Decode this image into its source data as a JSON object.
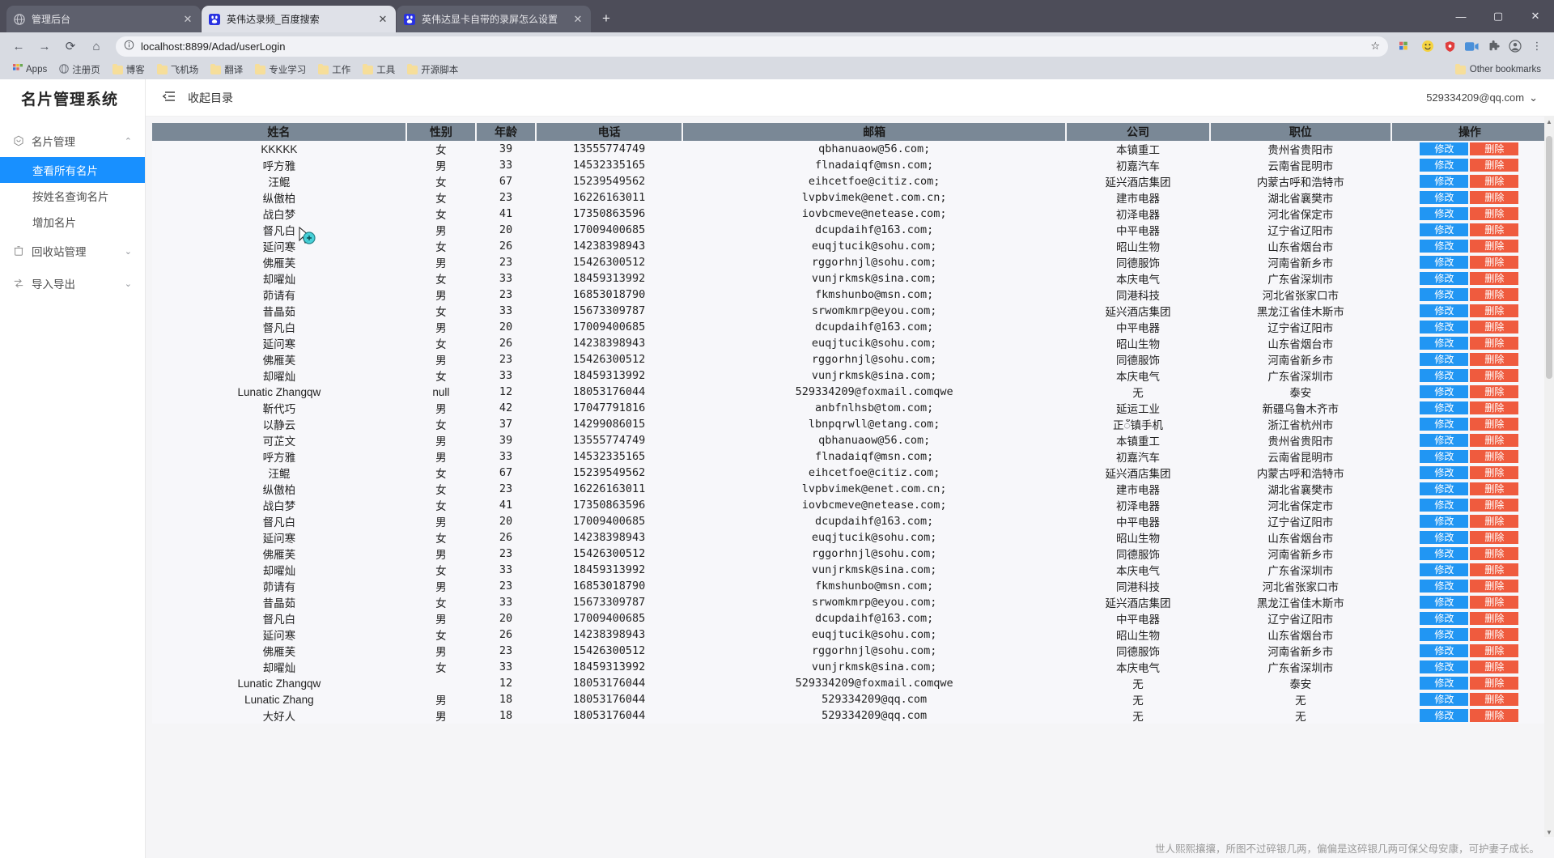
{
  "browser": {
    "tabs": [
      {
        "title": "管理后台",
        "favicon": "globe-icon",
        "active": false
      },
      {
        "title": "英伟达录频_百度搜索",
        "favicon": "baidu-icon",
        "active": true
      },
      {
        "title": "英伟达显卡自带的录屏怎么设置",
        "favicon": "baidu-icon",
        "active": false
      }
    ],
    "new_tab_label": "+",
    "window_controls": {
      "minimize": "—",
      "maximize": "▢",
      "close": "✕"
    },
    "nav": {
      "back": "←",
      "forward": "→",
      "reload": "⟳",
      "home": "⌂"
    },
    "omnibox": {
      "info_icon": "info-icon",
      "url": "localhost:8899/Adad/userLogin",
      "star": "☆"
    },
    "toolbar_icons": [
      "extension-icon",
      "emoji-icon",
      "shield-icon",
      "video-icon",
      "puzzle-icon",
      "profile-icon"
    ],
    "bookmarks": {
      "apps_label": "Apps",
      "items": [
        {
          "label": "注册页",
          "icon": "globe-icon"
        },
        {
          "label": "博客",
          "icon": "folder-icon"
        },
        {
          "label": "飞机场",
          "icon": "folder-icon"
        },
        {
          "label": "翻译",
          "icon": "folder-icon"
        },
        {
          "label": "专业学习",
          "icon": "folder-icon"
        },
        {
          "label": "工作",
          "icon": "folder-icon"
        },
        {
          "label": "工具",
          "icon": "folder-icon"
        },
        {
          "label": "开源脚本",
          "icon": "folder-icon"
        }
      ],
      "other_bookmarks": "Other bookmarks"
    }
  },
  "app": {
    "logo": "名片管理系统",
    "header": {
      "collapse_label": "收起目录",
      "collapse_icon": "menu-fold-icon",
      "user_email": "529334209@qq.com",
      "user_chevron": "⌄"
    },
    "sidebar": {
      "groups": [
        {
          "label": "名片管理",
          "icon": "card-icon",
          "chevron": "⌃",
          "expanded": true,
          "items": [
            {
              "label": "查看所有名片",
              "active": true
            },
            {
              "label": "按姓名查询名片",
              "active": false
            },
            {
              "label": "增加名片",
              "active": false
            }
          ]
        },
        {
          "label": "回收站管理",
          "icon": "recycle-icon",
          "chevron": "⌄",
          "expanded": false,
          "items": []
        },
        {
          "label": "导入导出",
          "icon": "transfer-icon",
          "chevron": "⌄",
          "expanded": false,
          "items": []
        }
      ]
    },
    "table": {
      "columns": [
        "姓名",
        "性别",
        "年龄",
        "电话",
        "邮箱",
        "公司",
        "职位",
        "操作"
      ],
      "action_buttons": {
        "edit": "修改",
        "delete": "删除"
      },
      "accent_edit": "#2196f3",
      "accent_delete": "#ef5b3e",
      "header_bg": "#7a8896",
      "rows": [
        [
          "KKKKK",
          "女",
          "39",
          "13555774749",
          "qbhanuaow@56.com;",
          "本镇重工",
          "贵州省贵阳市"
        ],
        [
          "呼方雅",
          "男",
          "33",
          "14532335165",
          "flnadaiqf@msn.com;",
          "初嘉汽车",
          "云南省昆明市"
        ],
        [
          "汪鲲",
          "女",
          "67",
          "15239549562",
          "eihcetfoe@citiz.com;",
          "延兴酒店集团",
          "内蒙古呼和浩特市"
        ],
        [
          "纵傲柏",
          "女",
          "23",
          "16226163011",
          "lvpbvimek@enet.com.cn;",
          "建市电器",
          "湖北省襄樊市"
        ],
        [
          "战白梦",
          "女",
          "41",
          "17350863596",
          "iovbcmeve@netease.com;",
          "初泽电器",
          "河北省保定市"
        ],
        [
          "督凡白",
          "男",
          "20",
          "17009400685",
          "dcupdaihf@163.com;",
          "中平电器",
          "辽宁省辽阳市"
        ],
        [
          "延问寒",
          "女",
          "26",
          "14238398943",
          "euqjtucik@sohu.com;",
          "昭山生物",
          "山东省烟台市"
        ],
        [
          "佛雁芙",
          "男",
          "23",
          "15426300512",
          "rggorhnjl@sohu.com;",
          "同德服饰",
          "河南省新乡市"
        ],
        [
          "却曜灿",
          "女",
          "33",
          "18459313992",
          "vunjrkmsk@sina.com;",
          "本庆电气",
          "广东省深圳市"
        ],
        [
          "茆请有",
          "男",
          "23",
          "16853018790",
          "fkmshunbo@msn.com;",
          "同港科技",
          "河北省张家口市"
        ],
        [
          "昔晶茹",
          "女",
          "33",
          "15673309787",
          "srwomkmrp@eyou.com;",
          "延兴酒店集团",
          "黑龙江省佳木斯市"
        ],
        [
          "督凡白",
          "男",
          "20",
          "17009400685",
          "dcupdaihf@163.com;",
          "中平电器",
          "辽宁省辽阳市"
        ],
        [
          "延问寒",
          "女",
          "26",
          "14238398943",
          "euqjtucik@sohu.com;",
          "昭山生物",
          "山东省烟台市"
        ],
        [
          "佛雁芙",
          "男",
          "23",
          "15426300512",
          "rggorhnjl@sohu.com;",
          "同德服饰",
          "河南省新乡市"
        ],
        [
          "却曜灿",
          "女",
          "33",
          "18459313992",
          "vunjrkmsk@sina.com;",
          "本庆电气",
          "广东省深圳市"
        ],
        [
          "Lunatic Zhangqw",
          "null",
          "12",
          "18053176044",
          "529334209@foxmail.comqwe",
          "无",
          "泰安"
        ],
        [
          "靳代巧",
          "男",
          "42",
          "17047791816",
          "anbfnlhsb@tom.com;",
          "延运工业",
          "新疆乌鲁木齐市"
        ],
        [
          "以静云",
          "女",
          "37",
          "14299086015",
          "lbnpqrwll@etang.com;",
          "正ँ镇手机",
          "浙江省杭州市"
        ],
        [
          "可芷文",
          "男",
          "39",
          "13555774749",
          "qbhanuaow@56.com;",
          "本镇重工",
          "贵州省贵阳市"
        ],
        [
          "呼方雅",
          "男",
          "33",
          "14532335165",
          "flnadaiqf@msn.com;",
          "初嘉汽车",
          "云南省昆明市"
        ],
        [
          "汪鲲",
          "女",
          "67",
          "15239549562",
          "eihcetfoe@citiz.com;",
          "延兴酒店集团",
          "内蒙古呼和浩特市"
        ],
        [
          "纵傲柏",
          "女",
          "23",
          "16226163011",
          "lvpbvimek@enet.com.cn;",
          "建市电器",
          "湖北省襄樊市"
        ],
        [
          "战白梦",
          "女",
          "41",
          "17350863596",
          "iovbcmeve@netease.com;",
          "初泽电器",
          "河北省保定市"
        ],
        [
          "督凡白",
          "男",
          "20",
          "17009400685",
          "dcupdaihf@163.com;",
          "中平电器",
          "辽宁省辽阳市"
        ],
        [
          "延问寒",
          "女",
          "26",
          "14238398943",
          "euqjtucik@sohu.com;",
          "昭山生物",
          "山东省烟台市"
        ],
        [
          "佛雁芙",
          "男",
          "23",
          "15426300512",
          "rggorhnjl@sohu.com;",
          "同德服饰",
          "河南省新乡市"
        ],
        [
          "却曜灿",
          "女",
          "33",
          "18459313992",
          "vunjrkmsk@sina.com;",
          "本庆电气",
          "广东省深圳市"
        ],
        [
          "茆请有",
          "男",
          "23",
          "16853018790",
          "fkmshunbo@msn.com;",
          "同港科技",
          "河北省张家口市"
        ],
        [
          "昔晶茹",
          "女",
          "33",
          "15673309787",
          "srwomkmrp@eyou.com;",
          "延兴酒店集团",
          "黑龙江省佳木斯市"
        ],
        [
          "督凡白",
          "男",
          "20",
          "17009400685",
          "dcupdaihf@163.com;",
          "中平电器",
          "辽宁省辽阳市"
        ],
        [
          "延问寒",
          "女",
          "26",
          "14238398943",
          "euqjtucik@sohu.com;",
          "昭山生物",
          "山东省烟台市"
        ],
        [
          "佛雁芙",
          "男",
          "23",
          "15426300512",
          "rggorhnjl@sohu.com;",
          "同德服饰",
          "河南省新乡市"
        ],
        [
          "却曜灿",
          "女",
          "33",
          "18459313992",
          "vunjrkmsk@sina.com;",
          "本庆电气",
          "广东省深圳市"
        ],
        [
          "Lunatic Zhangqw",
          "",
          "12",
          "18053176044",
          "529334209@foxmail.comqwe",
          "无",
          "泰安"
        ],
        [
          "Lunatic Zhang",
          "男",
          "18",
          "18053176044",
          "529334209@qq.com",
          "无",
          "无"
        ],
        [
          "大好人",
          "男",
          "18",
          "18053176044",
          "529334209@qq.com",
          "无",
          "无"
        ]
      ]
    },
    "footer_note": "世人熙熙攘攘，所图不过碎银几两，偏偏是这碎银几两可保父母安康，可护妻子成长。"
  }
}
